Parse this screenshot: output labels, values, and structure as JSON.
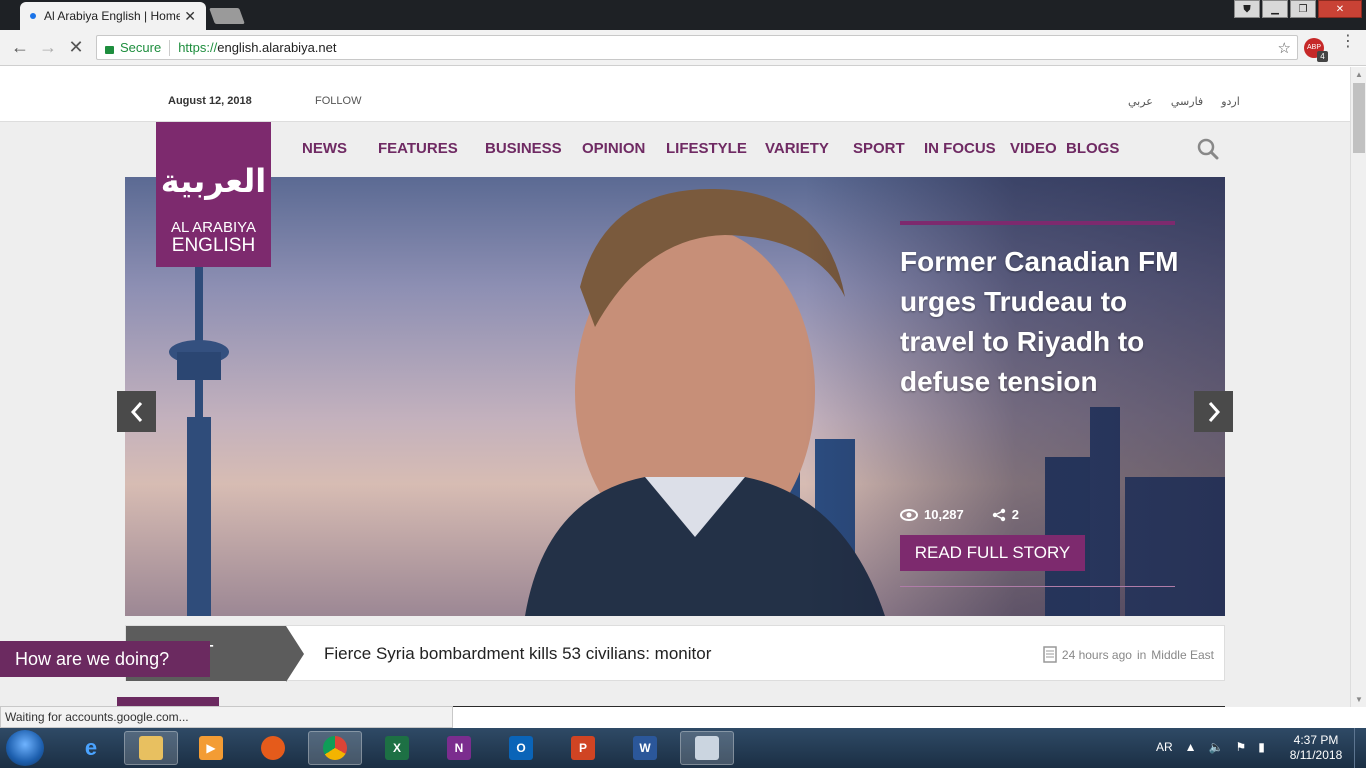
{
  "browser": {
    "tab_title": "Al Arabiya English | Home",
    "url_secure_label": "Secure",
    "url_scheme": "https://",
    "url_host": "english.alarabiya.net",
    "extension_badge": "4",
    "extension_label": "ABP",
    "status_text": "Waiting for accounts.google.com..."
  },
  "topbar": {
    "date": "August 12, 2018",
    "follow": "FOLLOW",
    "languages": [
      "عربي",
      "فارسي",
      "اردو"
    ]
  },
  "logo": {
    "arabic": "العربية",
    "line1": "AL ARABIYA",
    "line2": "ENGLISH"
  },
  "nav": [
    "NEWS",
    "FEATURES",
    "BUSINESS",
    "OPINION",
    "LIFESTYLE",
    "VARIETY",
    "SPORT",
    "IN FOCUS",
    "VIDEO",
    "BLOGS"
  ],
  "hero": {
    "headline": "Former Canadian FM urges Trudeau to travel to Riyadh to defuse tension",
    "views": "10,287",
    "shares": "2",
    "cta": "READ FULL STORY"
  },
  "ticker": {
    "label": "LATEST",
    "label_visible": "ST",
    "headline": "Fierce Syria bombardment kills 53 civilians: monitor",
    "time": "24 hours ago",
    "section_prefix": "in",
    "section": "Middle East"
  },
  "feedback": "How are we doing?",
  "taskbar": {
    "lang": "AR",
    "time": "4:37 PM",
    "date": "8/11/2018"
  },
  "colors": {
    "brand": "#7d2a6e",
    "nav_text": "#6f2a63"
  }
}
